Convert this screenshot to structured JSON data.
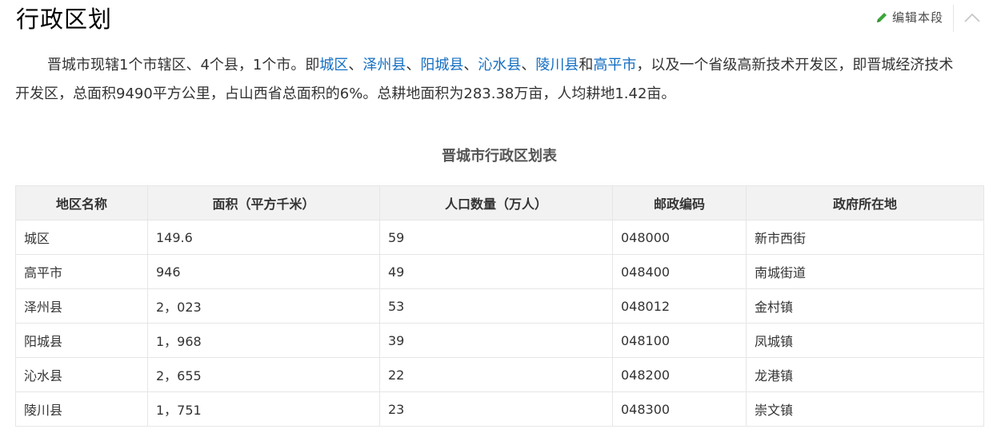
{
  "header": {
    "title": "行政区划",
    "edit_label": "编辑本段",
    "pencil_icon": "pencil-icon",
    "collapse_icon": "chevron-up-icon"
  },
  "paragraph": {
    "t1": "晋城市现辖1个市辖区、4个县，1个市。即",
    "link_chengqu": "城区",
    "sep1": "、",
    "link_zezhou": "泽州县",
    "sep2": "、",
    "link_yangcheng": "阳城县",
    "sep3": "、",
    "link_qinshui": "沁水县",
    "sep4": "、",
    "link_lingchuan": "陵川县",
    "and": "和",
    "link_gaoping": "高平市",
    "t2": "，以及一个省级高新技术开发区，即晋城经济技术开发区，总面积9490平方公里，占山西省总面积的6%。总耕地面积为283.38万亩，人均耕地1.42亩。"
  },
  "table": {
    "caption": "晋城市行政区划表",
    "headers": [
      "地区名称",
      "面积（平方千米）",
      "人口数量（万人）",
      "邮政编码",
      "政府所在地"
    ],
    "rows": [
      [
        "城区",
        "149.6",
        "59",
        "048000",
        "新市西街"
      ],
      [
        "高平市",
        "946",
        "49",
        "048400",
        "南城街道"
      ],
      [
        "泽州县",
        "2，023",
        "53",
        "048012",
        "金村镇"
      ],
      [
        "阳城县",
        "1，968",
        "39",
        "048100",
        "凤城镇"
      ],
      [
        "沁水县",
        "2，655",
        "22",
        "048200",
        "龙港镇"
      ],
      [
        "陵川县",
        "1，751",
        "23",
        "048300",
        "崇文镇"
      ]
    ]
  },
  "colors": {
    "link": "#136ec2",
    "pencil": "#3aa63a",
    "header_bg": "#f2f2f2",
    "border": "#e6e6e6"
  }
}
